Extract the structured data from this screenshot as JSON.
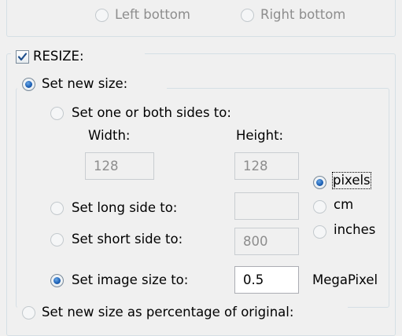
{
  "position": {
    "left_bottom": "Left bottom",
    "right_bottom": "Right bottom"
  },
  "resize": {
    "label": "RESIZE:",
    "checked": true,
    "set_new_size": {
      "label": "Set new size:",
      "selected": true
    },
    "set_sides": {
      "label": "Set one or both sides to:",
      "width_label": "Width:",
      "height_label": "Height:",
      "width_value": "128",
      "height_value": "128"
    },
    "set_long_side": {
      "label": "Set long side to:",
      "value": ""
    },
    "set_short_side": {
      "label": "Set short side to:",
      "value": "800"
    },
    "set_image_size": {
      "label": "Set image size to:",
      "value": "0.5",
      "unit": "MegaPixel",
      "selected": true
    },
    "units": {
      "pixels": "pixels",
      "cm": "cm",
      "inches": "inches",
      "selected": "pixels"
    },
    "percentage": {
      "label": "Set new size as percentage of original:"
    }
  }
}
